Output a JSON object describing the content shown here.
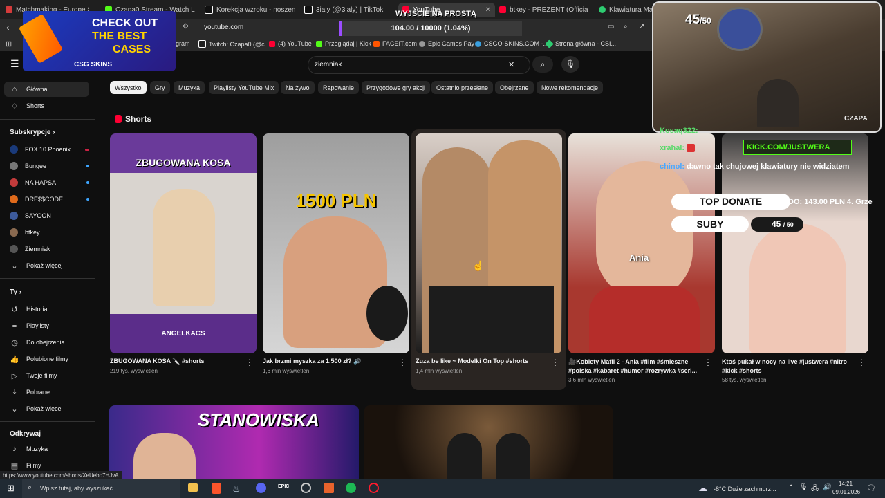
{
  "browser": {
    "tabs": [
      {
        "label": "Matchmaking - Europe Sv",
        "color": "#d43b3b"
      },
      {
        "label": "Czapa0 Stream - Watch Live on",
        "color": "#53fc18"
      },
      {
        "label": "Korekcja wzroku - noszenie ok",
        "color": "#ffffff"
      },
      {
        "label": "3ialy (@3ialy) | TikTok",
        "color": "#ffffff"
      },
      {
        "label": "YouTube",
        "color": "#ff0033"
      },
      {
        "label": "btkey - PREZENT (Official Vide",
        "color": "#ff0033"
      },
      {
        "label": "Klawiatura Magnet",
        "color": "#2ecc71"
      }
    ],
    "url": "youtube.com",
    "bookmarks": [
      {
        "label": "gram",
        "color": "#c13584"
      },
      {
        "label": "Twitch: Czapa0 (@c...",
        "color": "#ffffff"
      },
      {
        "label": "(4) YouTube",
        "color": "#ff0033"
      },
      {
        "label": "Przeglądaj | Kick",
        "color": "#53fc18"
      },
      {
        "label": "FACEIT.com",
        "color": "#ff5500"
      },
      {
        "label": "Epic Games Pay",
        "color": "#cccccc"
      },
      {
        "label": "CSGO-SKINS.COM -...",
        "color": "#3aa0e0"
      },
      {
        "label": "Strona główna - CSI...",
        "color": "#2ecc71"
      }
    ],
    "status_url": "https://www.youtube.com/shorts/XeUebp7HJvA"
  },
  "stream_overlay": {
    "ad": {
      "line1": "CHECK OUT",
      "line2": "THE BEST",
      "line3": "CASES",
      "brand": "CSG SKINS"
    },
    "goal": {
      "title": "WYJŚCIE NA PROSTĄ",
      "progress_text": "104.00 / 10000 (1.04%)",
      "progress": 0.0104
    },
    "sub_counter": {
      "current": "45",
      "total": "/50"
    },
    "cam_label": "CZAPA",
    "chat": [
      {
        "user": "Kosaq322:",
        "text": ""
      },
      {
        "user": "xrahal:",
        "text": ""
      },
      {
        "user": "chinol:",
        "text": "dawno tak chujowej klawiatury nie widziatem"
      }
    ],
    "kick_label": "KICK.COM/JUSTWERA",
    "top_donate": {
      "label": "TOP DONATE",
      "ticker": "DO: 143.00 PLN 4. Grze"
    },
    "suby": {
      "label": "SUBY",
      "current": "45",
      "total": "/ 50"
    }
  },
  "youtube": {
    "search_query": "ziemniak",
    "chips": [
      "Wszystko",
      "Gry",
      "Muzyka",
      "Playlisty YouTube Mix",
      "Na żywo",
      "Rapowanie",
      "Przygodowe gry akcji",
      "Ostatnio przesłane",
      "Obejrzane",
      "Nowe rekomendacje"
    ],
    "sidebar": {
      "main": [
        {
          "label": "Główna",
          "icon": "home-icon"
        },
        {
          "label": "Shorts",
          "icon": "shorts-icon"
        }
      ],
      "subs_header": "Subskrypcje",
      "subs": [
        {
          "label": "FOX 10 Phoenix",
          "color": "#1a3a7a",
          "badge": "live"
        },
        {
          "label": "Bungee",
          "color": "#777"
        },
        {
          "label": "NA HAPSA",
          "color": "#c23b3b"
        },
        {
          "label": "DRE$$CODE",
          "color": "#e06a1b"
        },
        {
          "label": "SAYGON",
          "color": "#3d5a9a"
        },
        {
          "label": "btkey",
          "color": "#8a6a50"
        },
        {
          "label": "Ziemniak",
          "color": "#555"
        },
        {
          "label": "Pokaż więcej",
          "color": ""
        }
      ],
      "you_header": "Ty",
      "you": [
        "Historia",
        "Playlisty",
        "Do obejrzenia",
        "Polubione filmy",
        "Twoje filmy",
        "Pobrane",
        "Pokaż więcej"
      ],
      "explore_header": "Odkrywaj",
      "explore": [
        "Muzyka",
        "Filmy"
      ]
    },
    "shorts_header": "Shorts",
    "shorts": [
      {
        "title": "ZBUGOWANA KOSA 🔪 #shorts",
        "views": "219 tys. wyświetleń",
        "overlay": "ZBUGOWANA KOSA",
        "bottom": "ANGELKACS"
      },
      {
        "title": "Jak brzmi myszka za 1.500 zł? 🔊",
        "views": "1,6 mln wyświetleń",
        "overlay": "1500 PLN",
        "bottom": ""
      },
      {
        "title": "Zuza be like ~ Modelki On Top #shorts",
        "views": "1,4 mln wyświetleń",
        "overlay": "",
        "bottom": ""
      },
      {
        "title": "🎥Kobiety Mafii 2 - Ania #film #śmieszne #polska #kabaret #humor #rozrywka #seri...",
        "views": "3,6 mln wyświetleń",
        "overlay": "Ania",
        "bottom": ""
      },
      {
        "title": "Ktoś pukał w nocy na live #justwera #nitro #kick #shorts",
        "views": "58 tys. wyświetleń",
        "overlay": "",
        "bottom": ""
      }
    ],
    "video_thumb_text": "STANOWISKA"
  },
  "taskbar": {
    "search_placeholder": "Wpisz tutaj, aby wyszukać",
    "weather": "-8°C  Duże zachmurz...",
    "time": "14:21",
    "date": "09.01.2026"
  }
}
